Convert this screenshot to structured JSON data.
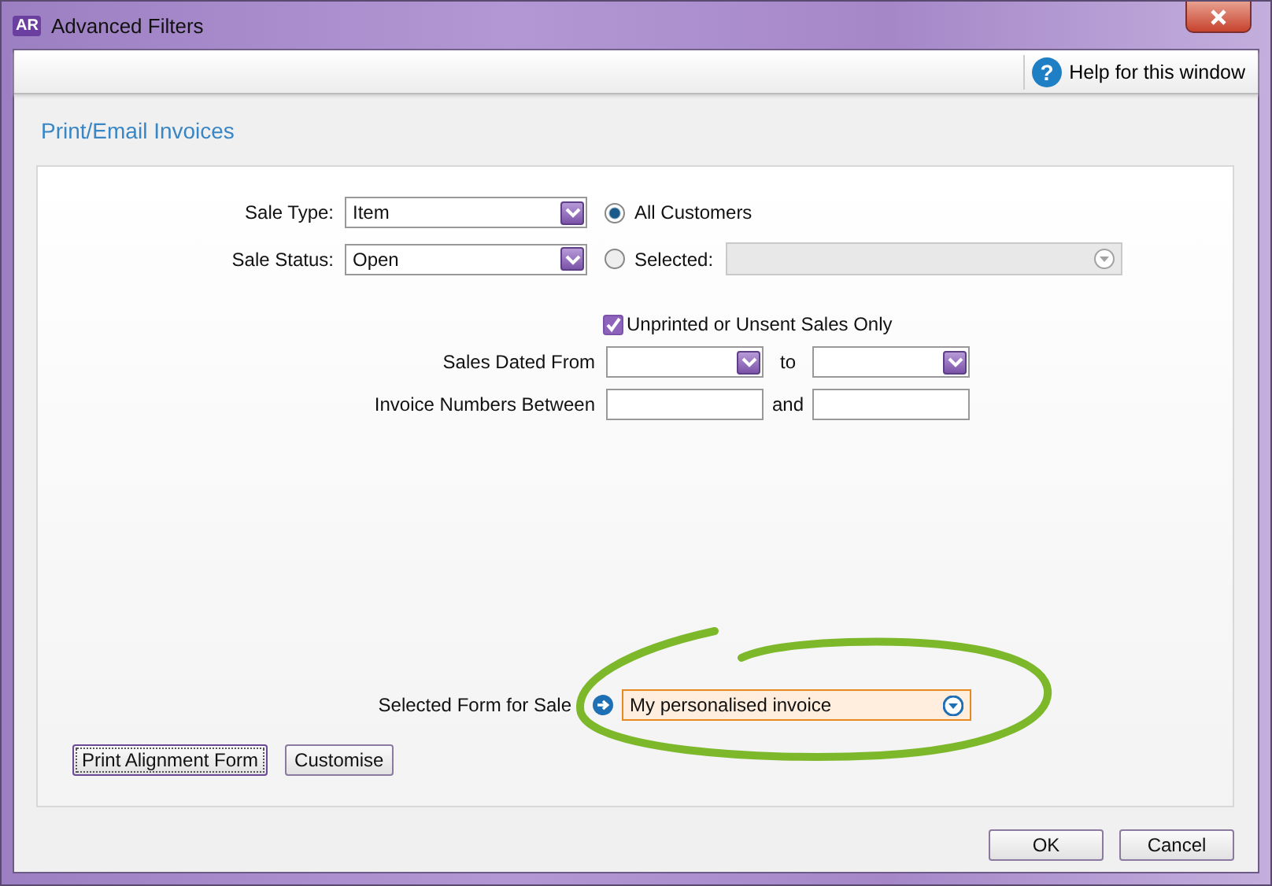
{
  "window": {
    "title": "Advanced Filters",
    "app_badge": "AR"
  },
  "toolbar": {
    "help_glyph": "?",
    "help": "Help for this window"
  },
  "heading": "Print/Email Invoices",
  "selects": [
    {
      "label": "Sale Type:",
      "value": "Item"
    },
    {
      "label": "Sale Status:",
      "value": "Open"
    }
  ],
  "customer_options": [
    {
      "label": "All Customers",
      "selected": true
    },
    {
      "label": "Selected:",
      "selected": false
    }
  ],
  "unprinted_only": {
    "label": "Unprinted or Unsent Sales Only",
    "checked": true
  },
  "date_range": {
    "label": "Sales Dated From",
    "joiner": "to"
  },
  "invoice_range": {
    "label": "Invoice Numbers Between",
    "joiner": "and"
  },
  "selected_form": {
    "label": "Selected Form for Sale",
    "value": "My personalised invoice",
    "highlighted": true
  },
  "panel_buttons": [
    {
      "label": "Print Alignment Form",
      "focused": true
    },
    {
      "label": "Customise",
      "focused": false
    }
  ],
  "dialog_buttons": [
    "OK",
    "Cancel"
  ]
}
